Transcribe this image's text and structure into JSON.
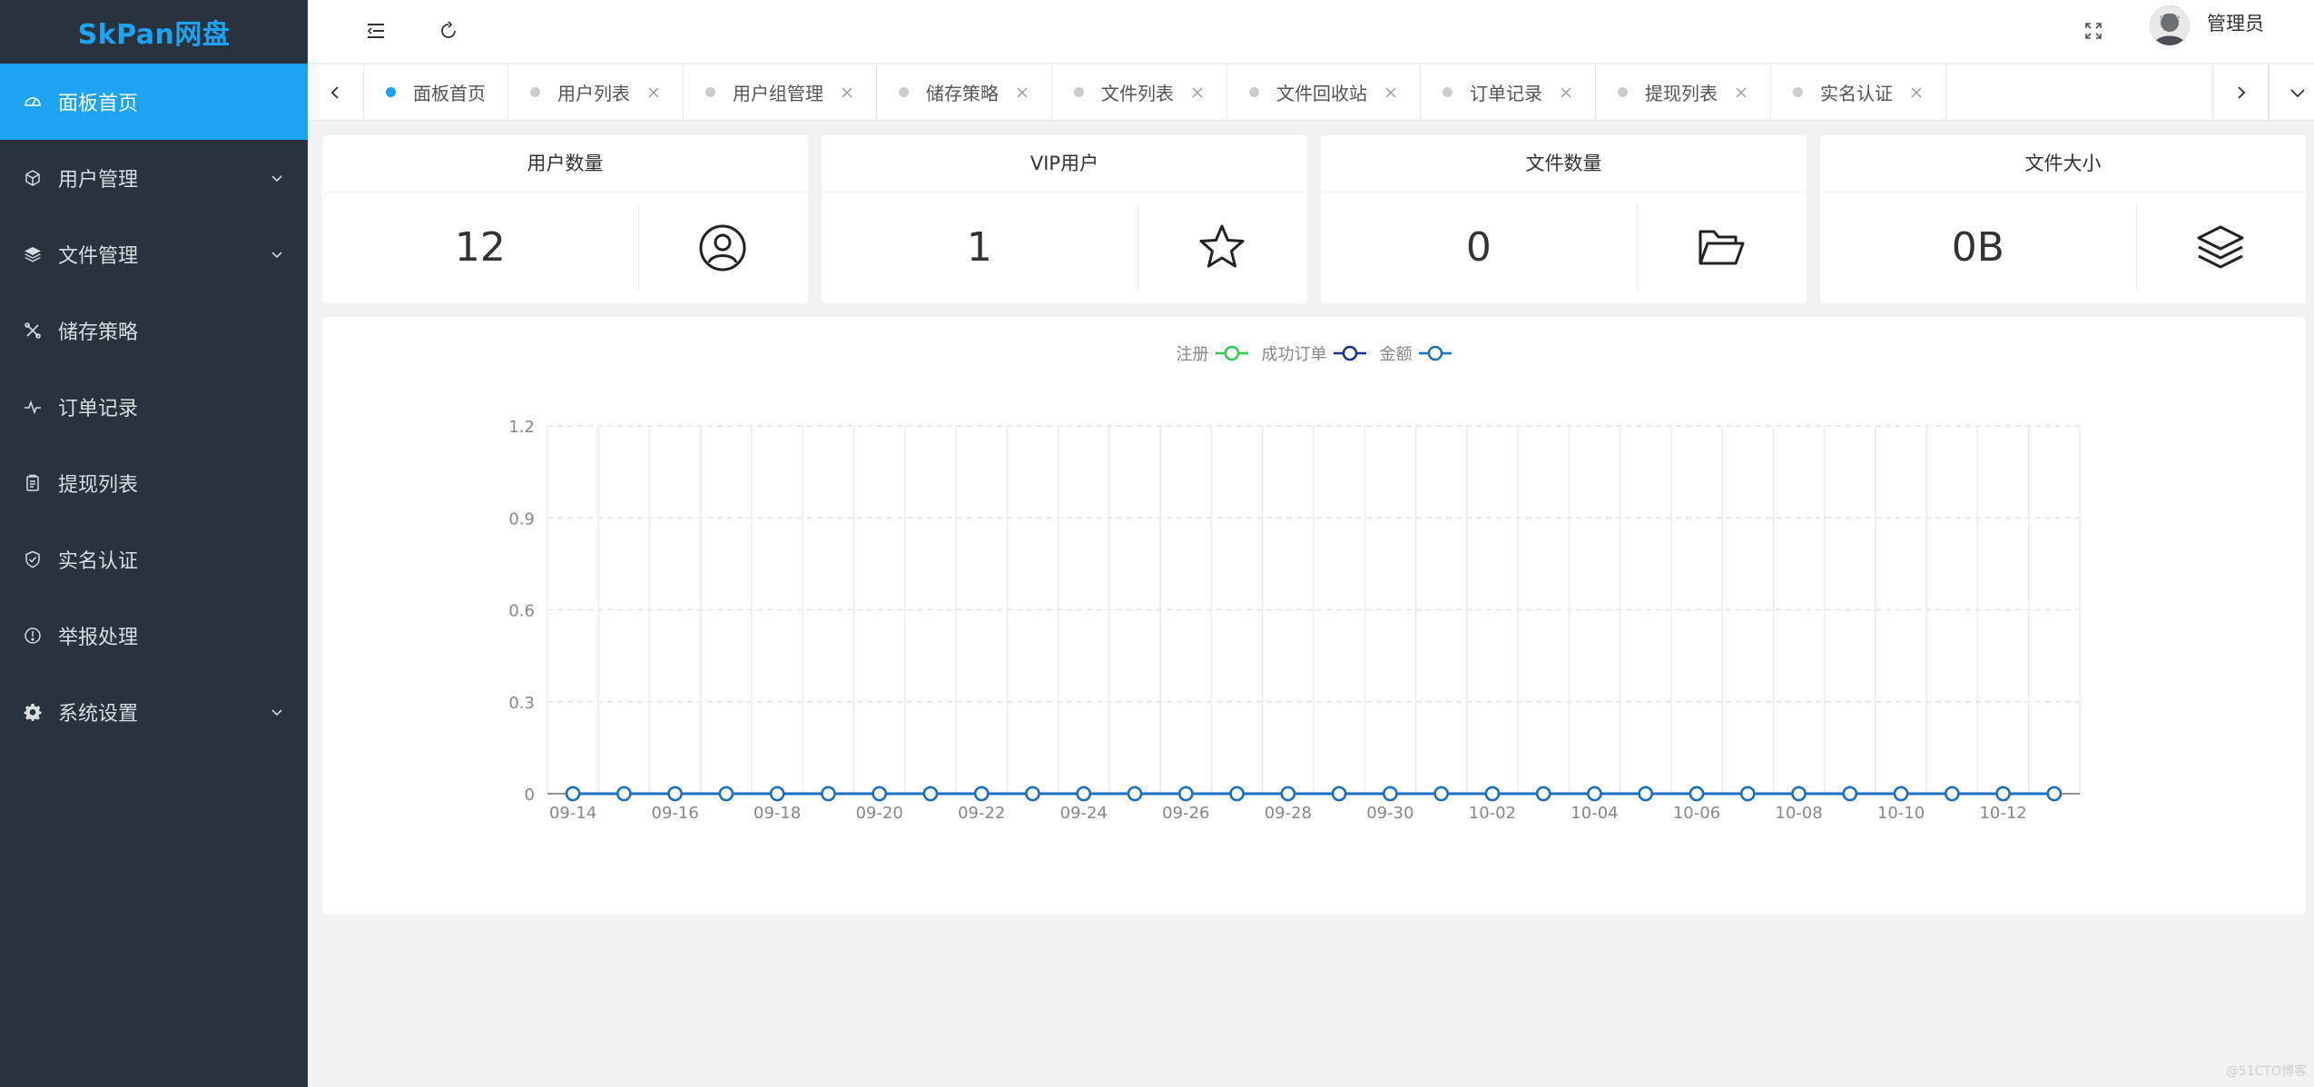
{
  "app": {
    "logo": "SkPan网盘"
  },
  "sidebar": {
    "items": [
      {
        "label": "面板首页",
        "icon": "dashboard-icon",
        "active": true
      },
      {
        "label": "用户管理",
        "icon": "cube-icon",
        "expandable": true
      },
      {
        "label": "文件管理",
        "icon": "layers-icon",
        "expandable": true
      },
      {
        "label": "储存策略",
        "icon": "tools-icon"
      },
      {
        "label": "订单记录",
        "icon": "pulse-icon"
      },
      {
        "label": "提现列表",
        "icon": "clipboard-icon"
      },
      {
        "label": "实名认证",
        "icon": "shield-check-icon"
      },
      {
        "label": "举报处理",
        "icon": "info-circle-icon"
      },
      {
        "label": "系统设置",
        "icon": "gear-icon",
        "expandable": true
      }
    ]
  },
  "header": {
    "user_name": "管理员"
  },
  "tabs": [
    {
      "label": "面板首页",
      "active": true,
      "closable": false
    },
    {
      "label": "用户列表",
      "closable": true
    },
    {
      "label": "用户组管理",
      "closable": true
    },
    {
      "label": "储存策略",
      "closable": true
    },
    {
      "label": "文件列表",
      "closable": true
    },
    {
      "label": "文件回收站",
      "closable": true
    },
    {
      "label": "订单记录",
      "closable": true
    },
    {
      "label": "提现列表",
      "closable": true
    },
    {
      "label": "实名认证",
      "closable": true
    }
  ],
  "stats": [
    {
      "title": "用户数量",
      "value": "12",
      "icon": "user-circle-icon"
    },
    {
      "title": "VIP用户",
      "value": "1",
      "icon": "star-icon"
    },
    {
      "title": "文件数量",
      "value": "0",
      "icon": "folder-open-icon"
    },
    {
      "title": "文件大小",
      "value": "0B",
      "icon": "layers-icon"
    }
  ],
  "colors": {
    "accent": "#1ea2f2",
    "sidebar_bg": "#28333e",
    "legend_register": "#2ecc52",
    "legend_orders": "#1b2e8f",
    "legend_amount": "#1c70c4"
  },
  "chart_data": {
    "type": "line",
    "legend_position": "top-center",
    "series_names": [
      "注册",
      "成功订单",
      "金额"
    ],
    "x": [
      "09-14",
      "09-15",
      "09-16",
      "09-17",
      "09-18",
      "09-19",
      "09-20",
      "09-21",
      "09-22",
      "09-23",
      "09-24",
      "09-25",
      "09-26",
      "09-27",
      "09-28",
      "09-29",
      "09-30",
      "10-01",
      "10-02",
      "10-03",
      "10-04",
      "10-05",
      "10-06",
      "10-07",
      "10-08",
      "10-09",
      "10-10",
      "10-11",
      "10-12",
      "10-13"
    ],
    "x_tick_labels": [
      "09-14",
      "09-16",
      "09-18",
      "09-20",
      "09-22",
      "09-24",
      "09-26",
      "09-28",
      "09-30",
      "10-02",
      "10-04",
      "10-06",
      "10-08",
      "10-10",
      "10-12"
    ],
    "y_ticks": [
      "0",
      "0.3",
      "0.6",
      "0.9",
      "1.2"
    ],
    "ylim": [
      0,
      1.2
    ],
    "grid": true,
    "series": [
      {
        "name": "注册",
        "values": [
          0,
          0,
          0,
          0,
          0,
          0,
          0,
          0,
          0,
          0,
          0,
          0,
          0,
          0,
          0,
          0,
          0,
          0,
          0,
          0,
          0,
          0,
          0,
          0,
          0,
          0,
          0,
          0,
          0,
          0
        ]
      },
      {
        "name": "成功订单",
        "values": [
          0,
          0,
          0,
          0,
          0,
          0,
          0,
          0,
          0,
          0,
          0,
          0,
          0,
          0,
          0,
          0,
          0,
          0,
          0,
          0,
          0,
          0,
          0,
          0,
          0,
          0,
          0,
          0,
          0,
          0
        ]
      },
      {
        "name": "金额",
        "values": [
          0,
          0,
          0,
          0,
          0,
          0,
          0,
          0,
          0,
          0,
          0,
          0,
          0,
          0,
          0,
          0,
          0,
          0,
          0,
          0,
          0,
          0,
          0,
          0,
          0,
          0,
          0,
          0,
          0,
          0
        ]
      }
    ]
  },
  "watermark": "@51CTO博客"
}
